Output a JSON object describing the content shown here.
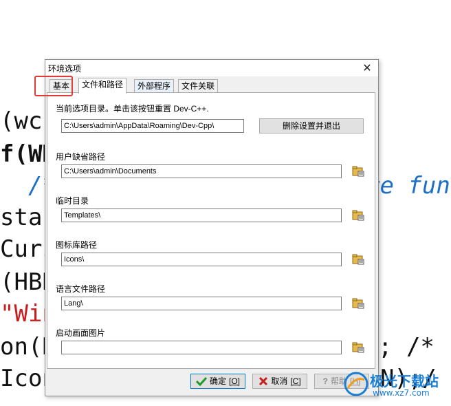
{
  "background_code": {
    "lines": [
      "(wc",
      "f(WN",
      "  /*",
      "star",
      "Curs",
      "(HBR",
      "\"Win",
      "on(H",
      "Icon"
    ],
    "frag_right_1": "re fun",
    "frag_right_2": "; /*",
    "frag_right_3": "N);/"
  },
  "dialog": {
    "title": "环境选项",
    "close_glyph": "✕",
    "tabs": [
      "基本",
      "文件和路径",
      "外部程序",
      "文件关联"
    ],
    "active_tab": "文件和路径",
    "config_dir_label": "当前选项目录。单击该按钮重置 Dev-C++.",
    "config_dir_value": "C:\\Users\\admin\\AppData\\Roaming\\Dev-Cpp\\",
    "reset_button": "删除设置并退出",
    "fields": [
      {
        "label": "用户缺省路径",
        "value": "C:\\Users\\admin\\Documents"
      },
      {
        "label": "临时目录",
        "value": "Templates\\"
      },
      {
        "label": "图标库路径",
        "value": "Icons\\"
      },
      {
        "label": "语言文件路径",
        "value": "Lang\\"
      },
      {
        "label": "启动画面图片",
        "value": ""
      }
    ],
    "ok_button": {
      "text": "确定",
      "mnemonic": "[O]"
    },
    "cancel_button": {
      "text": "取消",
      "mnemonic": "[C]"
    },
    "help_button": {
      "text": "帮助",
      "mnemonic": "[H]"
    }
  },
  "watermark": {
    "text": "极光下载站",
    "sub": "www.xz7.com"
  },
  "colors": {
    "accent": "#0078d7",
    "highlight": "#e03a3a",
    "comment": "#1c6fc7",
    "string": "#c81e1e"
  }
}
